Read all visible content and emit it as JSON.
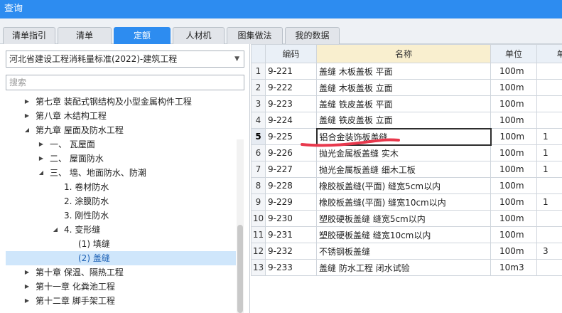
{
  "window": {
    "title": "查询"
  },
  "tabs": [
    {
      "label": "清单指引",
      "active": false
    },
    {
      "label": "清单",
      "active": false
    },
    {
      "label": "定额",
      "active": true
    },
    {
      "label": "人材机",
      "active": false
    },
    {
      "label": "图集做法",
      "active": false
    },
    {
      "label": "我的数据",
      "active": false
    }
  ],
  "left": {
    "standard": "河北省建设工程消耗量标准(2022)-建筑工程",
    "search_placeholder": "搜索",
    "tree": [
      {
        "label": "第七章 装配式钢结构及小型金属构件工程",
        "expander": "▶"
      },
      {
        "label": "第八章 木结构工程",
        "expander": "▶"
      },
      {
        "label": "第九章 屋面及防水工程",
        "expander": "◢"
      },
      {
        "label": "一、 瓦屋面",
        "expander": "▶"
      },
      {
        "label": "二、 屋面防水",
        "expander": "▶"
      },
      {
        "label": "三、 墙、地面防水、防潮",
        "expander": "◢"
      },
      {
        "label": "1. 卷材防水",
        "expander": ""
      },
      {
        "label": "2. 涂膜防水",
        "expander": ""
      },
      {
        "label": "3. 刚性防水",
        "expander": ""
      },
      {
        "label": "4. 变形缝",
        "expander": "◢"
      },
      {
        "label": "(1) 填缝",
        "expander": ""
      },
      {
        "label": "(2) 盖缝",
        "expander": "",
        "selected": true
      },
      {
        "label": "第十章 保温、隔热工程",
        "expander": "▶"
      },
      {
        "label": "第十一章 化粪池工程",
        "expander": "▶"
      },
      {
        "label": "第十二章 脚手架工程",
        "expander": "▶"
      }
    ]
  },
  "grid": {
    "headers": [
      "",
      "编码",
      "名称",
      "单位",
      "单"
    ],
    "rows": [
      {
        "no": "1",
        "code": "9-221",
        "name": "盖缝 木板盖板 平面",
        "unit": "100m",
        "price": ""
      },
      {
        "no": "2",
        "code": "9-222",
        "name": "盖缝 木板盖板 立面",
        "unit": "100m",
        "price": ""
      },
      {
        "no": "3",
        "code": "9-223",
        "name": "盖缝 铁皮盖板 平面",
        "unit": "100m",
        "price": ""
      },
      {
        "no": "4",
        "code": "9-224",
        "name": "盖缝 铁皮盖板 立面",
        "unit": "100m",
        "price": ""
      },
      {
        "no": "5",
        "code": "9-225",
        "name": "铝合金装饰板盖缝",
        "unit": "100m",
        "price": "1",
        "current": true
      },
      {
        "no": "6",
        "code": "9-226",
        "name": "抛光金属板盖缝 实木",
        "unit": "100m",
        "price": "1"
      },
      {
        "no": "7",
        "code": "9-227",
        "name": "抛光金属板盖缝 细木工板",
        "unit": "100m",
        "price": "1"
      },
      {
        "no": "8",
        "code": "9-228",
        "name": "橡胶板盖缝(平面) 缝宽5cm以内",
        "unit": "100m",
        "price": ""
      },
      {
        "no": "9",
        "code": "9-229",
        "name": "橡胶板盖缝(平面) 缝宽10cm以内",
        "unit": "100m",
        "price": "1"
      },
      {
        "no": "10",
        "code": "9-230",
        "name": "塑胶硬板盖缝 缝宽5cm以内",
        "unit": "100m",
        "price": ""
      },
      {
        "no": "11",
        "code": "9-231",
        "name": "塑胶硬板盖缝 缝宽10cm以内",
        "unit": "100m",
        "price": ""
      },
      {
        "no": "12",
        "code": "9-232",
        "name": "不锈钢板盖缝",
        "unit": "100m",
        "price": "3"
      },
      {
        "no": "13",
        "code": "9-233",
        "name": "盖缝 防水工程 闭水试验",
        "unit": "10m3",
        "price": ""
      }
    ]
  },
  "colors": {
    "accent": "#2d8cf0",
    "selection": "#cfe6fb",
    "annotation": "#e8394d"
  }
}
